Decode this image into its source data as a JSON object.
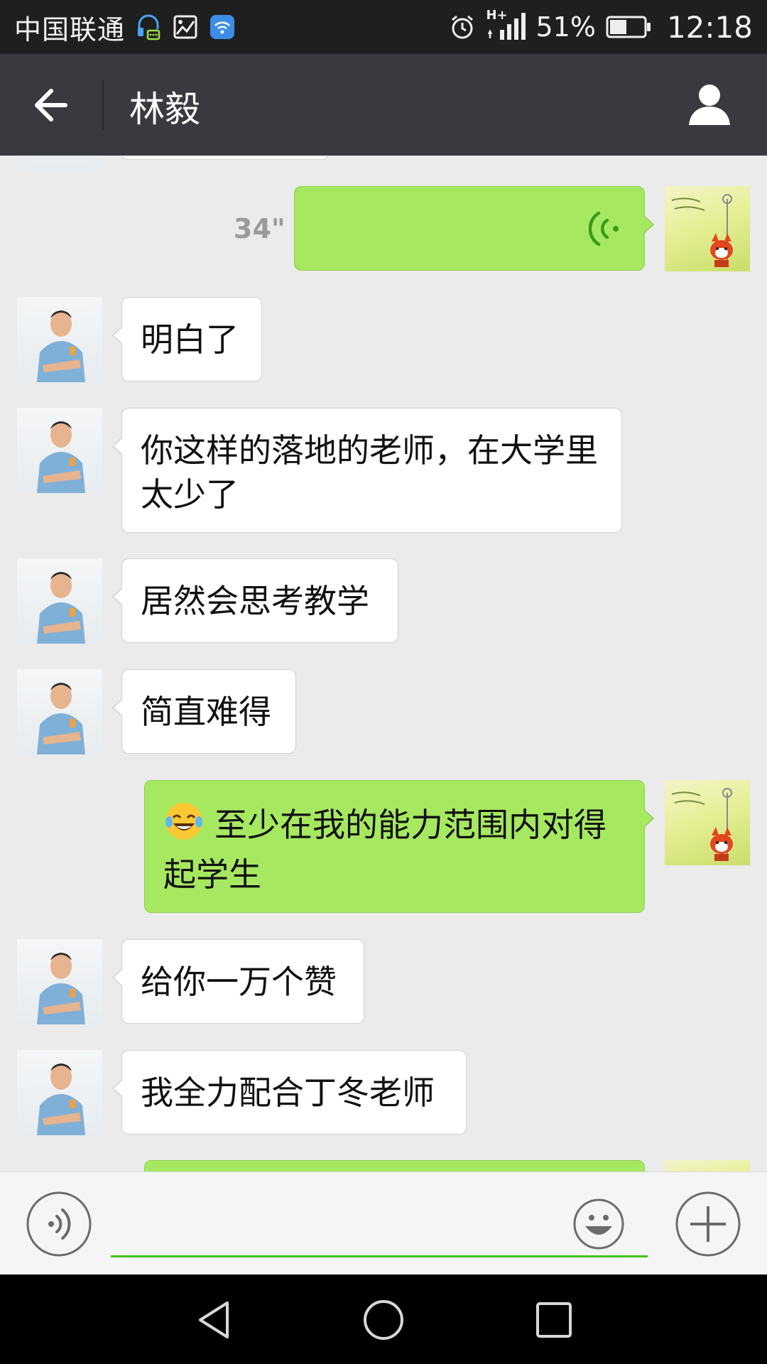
{
  "status_bar": {
    "carrier": "中国联通",
    "network_label": "H+",
    "battery_percent": "51%",
    "time": "12:18",
    "left_icons": [
      "headset-icon",
      "image-icon",
      "wifi-icon"
    ],
    "right_icons": [
      "alarm-icon",
      "signal-icon",
      "battery-icon"
    ],
    "battery_level": 0.51
  },
  "header": {
    "title": "林毅",
    "back_icon": "back-arrow-icon",
    "profile_icon": "person-icon"
  },
  "messages": [
    {
      "sender": "me",
      "type": "voice",
      "duration": "34\""
    },
    {
      "sender": "lin",
      "type": "text",
      "text": "明白了"
    },
    {
      "sender": "lin",
      "type": "text",
      "text": "你这样的落地的老师，在大学里太少了"
    },
    {
      "sender": "lin",
      "type": "text",
      "text": "居然会思考教学"
    },
    {
      "sender": "lin",
      "type": "text",
      "text": "简直难得"
    },
    {
      "sender": "me",
      "type": "text",
      "emoji": "laughing-tears-emoji",
      "text": "至少在我的能力范围内对得起学生"
    },
    {
      "sender": "lin",
      "type": "text",
      "text": "给你一万个赞"
    },
    {
      "sender": "lin",
      "type": "text",
      "text": "我全力配合丁冬老师"
    }
  ],
  "input_bar": {
    "voice_icon": "voice-icon",
    "emoji_icon": "smiley-icon",
    "plus_icon": "plus-icon",
    "input_value": "",
    "accent_color": "#45c01a"
  },
  "nav_bar": {
    "icons": [
      "nav-back-icon",
      "nav-home-icon",
      "nav-recents-icon"
    ]
  },
  "colors": {
    "header_bg": "#393a3f",
    "chat_bg": "#ebebeb",
    "outgoing_bubble": "#a6e860",
    "incoming_bubble": "#ffffff"
  }
}
